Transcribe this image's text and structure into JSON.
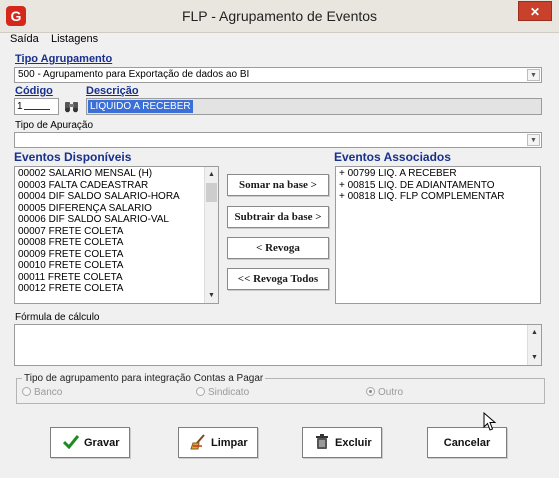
{
  "window": {
    "title": "FLP - Agrupamento de Eventos",
    "close_glyph": "✕",
    "app_icon_glyph": "G"
  },
  "menu": {
    "items": [
      "Saída",
      "Listagens"
    ]
  },
  "tipo_agrupamento": {
    "label": "Tipo Agrupamento",
    "value": "500 - Agrupamento para Exportação de dados ao BI"
  },
  "codigo": {
    "label": "Código",
    "value": "1"
  },
  "descricao": {
    "label": "Descrição",
    "value": "LIQUIDO A RECEBER"
  },
  "tipo_apuracao": {
    "label": "Tipo de Apuração",
    "value": ""
  },
  "eventos_disponiveis": {
    "label": "Eventos Disponíveis",
    "items": [
      "00002 SALARIO MENSAL (H)",
      "00003 FALTA CADEASTRAR",
      "00004 DIF SALDO SALARIO-HORA",
      "00005 DIFERENÇA  SALARIO",
      "00006 DIF SALDO SALARIO-VAL",
      "00007 FRETE COLETA",
      "00008 FRETE COLETA",
      "00009 FRETE COLETA",
      "00010 FRETE COLETA",
      "00011 FRETE COLETA",
      "00012 FRETE COLETA"
    ]
  },
  "actions": {
    "somar": "Somar  na base >",
    "subtrair": "Subtrair da base >",
    "revoga": "< Revoga",
    "revoga_todos": "<< Revoga Todos"
  },
  "eventos_associados": {
    "label": "Eventos Associados",
    "items": [
      "+ 00799 LIQ. A RECEBER",
      "+ 00815 LIQ. DE ADIANTAMENTO",
      "+ 00818 LIQ. FLP COMPLEMENTAR"
    ]
  },
  "formula": {
    "label": "Fórmula de cálculo",
    "value": ""
  },
  "integracao": {
    "label": "Tipo de agrupamento para integração Contas a Pagar",
    "options": [
      "Banco",
      "Sindicato",
      "Outro"
    ],
    "selected": "Outro"
  },
  "buttons": {
    "gravar": "Gravar",
    "limpar": "Limpar",
    "excluir": "Excluir",
    "cancelar": "Cancelar"
  },
  "colors": {
    "accent_blue": "#17308c",
    "selection_blue": "#3a6fd8",
    "close_red": "#c9412b"
  }
}
